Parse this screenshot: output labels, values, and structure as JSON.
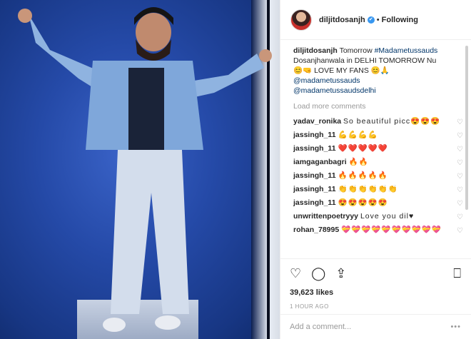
{
  "header": {
    "username": "diljitdosanjh",
    "following": "Following"
  },
  "caption": {
    "username": "diljitdosanjh",
    "text1": " Tomorrow ",
    "hashtag": "#Madametussauds",
    "text2": "Dosanjhanwala in DELHI TOMORROW Nu",
    "text3": "😊🤜 LOVE MY FANS 😊🙏",
    "mention1": "@madametussauds",
    "mention2": "@madametussaudsdelhi"
  },
  "load_more": "Load more comments",
  "comments": [
    {
      "user": "yadav_ronika",
      "text": "So beautiful picc😍😍😍"
    },
    {
      "user": "jassingh_11",
      "text": "💪💪💪💪"
    },
    {
      "user": "jassingh_11",
      "text": "❤️❤️❤️❤️❤️"
    },
    {
      "user": "iamgaganbagri",
      "text": "🔥🔥"
    },
    {
      "user": "jassingh_11",
      "text": "🔥🔥🔥🔥🔥"
    },
    {
      "user": "jassingh_11",
      "text": "👏👏👏👏👏👏"
    },
    {
      "user": "jassingh_11",
      "text": "😍😍😍😍😍"
    },
    {
      "user": "unwrittenpoetryyy",
      "text": "Love you dil♥"
    },
    {
      "user": "rohan_78995",
      "text": "💝💝💝💝💝💝💝💝💝💝"
    }
  ],
  "likes": "39,623 likes",
  "time": "1 HOUR AGO",
  "add_comment_placeholder": "Add a comment...",
  "more_menu": "•••"
}
